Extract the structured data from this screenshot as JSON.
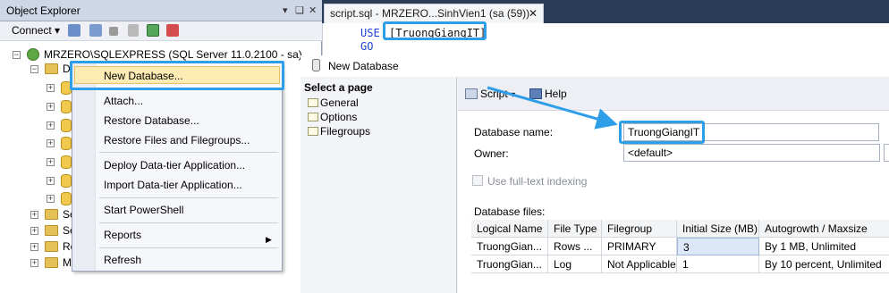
{
  "object_explorer": {
    "title": "Object Explorer",
    "pin": "❑",
    "close": "✕",
    "connect_label": "Connect",
    "server_node": "MRZERO\\SQLEXPRESS (SQL Server 11.0.2100 - sa)",
    "databases_node": "D",
    "other_nodes": [
      "Se",
      "Se",
      "Re",
      "M"
    ]
  },
  "context_menu": {
    "items": [
      "New Database...",
      "Attach...",
      "Restore Database...",
      "Restore Files and Filegroups...",
      "Deploy Data-tier Application...",
      "Import Data-tier Application...",
      "Start PowerShell",
      "Reports",
      "Refresh"
    ],
    "submenu_arrow": "▶"
  },
  "editor": {
    "tab_title": "script.sql - MRZERO...SinhVien1 (sa (59))",
    "tab_close": "✕",
    "line1_keyword": "USE",
    "line1_db": "[TruongGiangIT]",
    "line2": "GO"
  },
  "dialog": {
    "title": "New Database",
    "select_page": "Select a page",
    "pages": [
      "General",
      "Options",
      "Filegroups"
    ],
    "script_label": "Script",
    "help_label": "Help",
    "database_name_label": "Database name:",
    "database_name_value": "TruongGiangIT",
    "owner_label": "Owner:",
    "owner_value": "<default>",
    "fulltext_label": "Use full-text indexing",
    "files_label": "Database files:",
    "columns": [
      "Logical Name",
      "File Type",
      "Filegroup",
      "Initial Size (MB)",
      "Autogrowth / Maxsize"
    ],
    "rows": [
      [
        "TruongGian...",
        "Rows ...",
        "PRIMARY",
        "3",
        "By 1 MB, Unlimited"
      ],
      [
        "TruongGian...",
        "Log",
        "Not Applicable",
        "1",
        "By 10 percent, Unlimited"
      ]
    ]
  },
  "colors": {
    "highlight": "#2e9ee8",
    "menu_hover": "#fcebb2",
    "frame": "#2b3c56"
  }
}
